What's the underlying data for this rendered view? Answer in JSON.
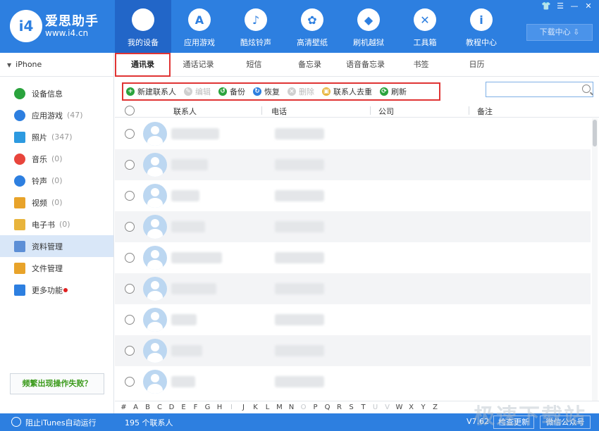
{
  "app": {
    "brand_name": "爱思助手",
    "brand_url": "www.i4.cn",
    "brand_mark": "i4"
  },
  "window_controls": [
    "👕",
    "☰",
    "—",
    "✕"
  ],
  "nav": [
    {
      "label": "我的设备",
      "icon": "apple-icon",
      "glyph": ""
    },
    {
      "label": "应用游戏",
      "icon": "app-store-icon",
      "glyph": "A"
    },
    {
      "label": "酷炫铃声",
      "icon": "bell-icon",
      "glyph": "♪"
    },
    {
      "label": "高清壁纸",
      "icon": "flower-icon",
      "glyph": "✿"
    },
    {
      "label": "刷机越狱",
      "icon": "box-icon",
      "glyph": "◆"
    },
    {
      "label": "工具箱",
      "icon": "tools-icon",
      "glyph": "✕"
    },
    {
      "label": "教程中心",
      "icon": "info-icon",
      "glyph": "i"
    }
  ],
  "download_center": "下载中心 ⇩",
  "sidebar": {
    "device": "iPhone",
    "items": [
      {
        "label": "设备信息",
        "count": "",
        "icon": "info-icon",
        "color": "#2aa33d"
      },
      {
        "label": "应用游戏",
        "count": "(47)",
        "icon": "app-icon",
        "color": "#2d7fe0"
      },
      {
        "label": "照片",
        "count": "(347)",
        "icon": "photo-icon",
        "color": "#2d9ae0"
      },
      {
        "label": "音乐",
        "count": "(0)",
        "icon": "music-icon",
        "color": "#e8453c"
      },
      {
        "label": "铃声",
        "count": "(0)",
        "icon": "bell-icon",
        "color": "#2d7fe0"
      },
      {
        "label": "视频",
        "count": "(0)",
        "icon": "video-icon",
        "color": "#e8a32a"
      },
      {
        "label": "电子书",
        "count": "(0)",
        "icon": "book-icon",
        "color": "#e8b43c"
      },
      {
        "label": "资料管理",
        "count": "",
        "icon": "data-icon",
        "color": "#5d8fd6"
      },
      {
        "label": "文件管理",
        "count": "",
        "icon": "file-icon",
        "color": "#e8a32a"
      },
      {
        "label": "更多功能",
        "count": "",
        "icon": "more-icon",
        "color": "#2d7fe0"
      }
    ],
    "help_button": "频繁出现操作失败？"
  },
  "tabs": [
    "通讯录",
    "通话记录",
    "短信",
    "备忘录",
    "语音备忘录",
    "书签",
    "日历"
  ],
  "toolbar": [
    {
      "label": "新建联系人",
      "icon": "plus-icon",
      "color": "#2aa33d",
      "glyph": "+",
      "enabled": true
    },
    {
      "label": "编辑",
      "icon": "edit-icon",
      "color": "#cfcfcf",
      "glyph": "✎",
      "enabled": false
    },
    {
      "label": "备份",
      "icon": "backup-icon",
      "color": "#2aa33d",
      "glyph": "↺",
      "enabled": true
    },
    {
      "label": "恢复",
      "icon": "restore-icon",
      "color": "#2d7fe0",
      "glyph": "↻",
      "enabled": true
    },
    {
      "label": "删除",
      "icon": "delete-icon",
      "color": "#cfcfcf",
      "glyph": "×",
      "enabled": false
    },
    {
      "label": "联系人去重",
      "icon": "dedupe-icon",
      "color": "#e8b43c",
      "glyph": "▣",
      "enabled": true
    },
    {
      "label": "刷新",
      "icon": "refresh-icon",
      "color": "#2aa33d",
      "glyph": "⟳",
      "enabled": true
    }
  ],
  "search": {
    "placeholder": ""
  },
  "table": {
    "columns": [
      "联系人",
      "电话",
      "公司",
      "备注"
    ],
    "row_count_visible": 9
  },
  "alphabet": [
    "#",
    "A",
    "B",
    "C",
    "D",
    "E",
    "F",
    "G",
    "H",
    "I",
    "J",
    "K",
    "L",
    "M",
    "N",
    "O",
    "P",
    "Q",
    "R",
    "S",
    "T",
    "U",
    "V",
    "W",
    "X",
    "Y",
    "Z"
  ],
  "alphabet_dim": [
    "I",
    "O",
    "U",
    "V"
  ],
  "status": {
    "itunes": "阻止iTunes自动运行",
    "contacts_count": "195 个联系人",
    "version": "V7.62",
    "check_update": "检查更新",
    "wechat": "微信公众号"
  },
  "watermark": "极速下载站"
}
